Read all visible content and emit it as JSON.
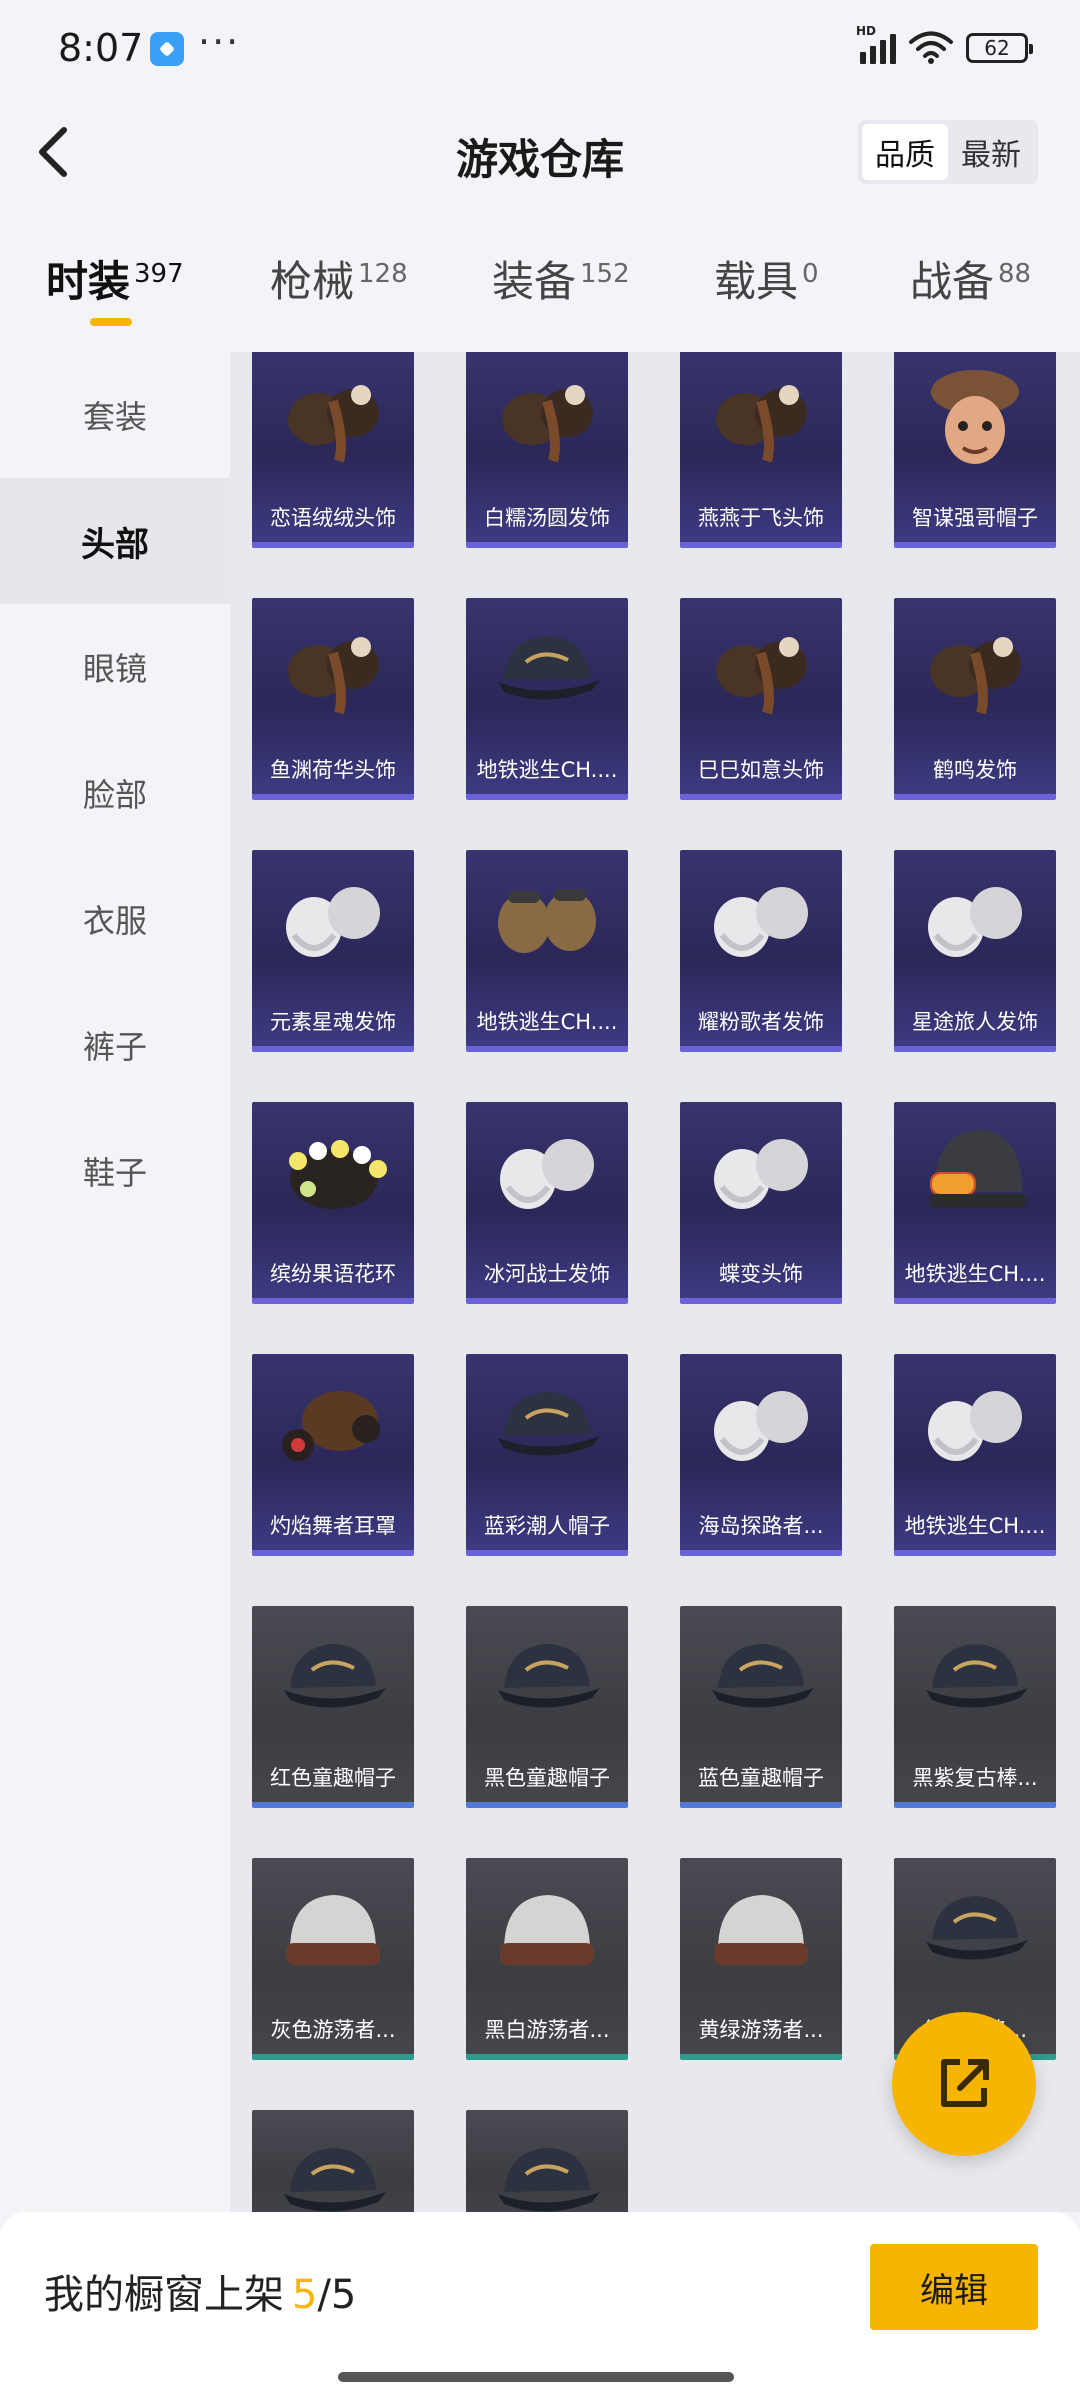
{
  "status_bar": {
    "time": "8:07",
    "more": "···",
    "network": "HD",
    "battery": "62"
  },
  "header": {
    "title": "游戏仓库",
    "sort_options": [
      {
        "label": "品质",
        "active": true
      },
      {
        "label": "最新",
        "active": false
      }
    ]
  },
  "category_tabs": [
    {
      "label": "时装",
      "count": "397",
      "active": true
    },
    {
      "label": "枪械",
      "count": "128",
      "active": false
    },
    {
      "label": "装备",
      "count": "152",
      "active": false
    },
    {
      "label": "载具",
      "count": "0",
      "active": false
    },
    {
      "label": "战备",
      "count": "88",
      "active": false
    }
  ],
  "sidebar": {
    "items": [
      {
        "label": "套装",
        "active": false
      },
      {
        "label": "头部",
        "active": true
      },
      {
        "label": "眼镜",
        "active": false
      },
      {
        "label": "脸部",
        "active": false
      },
      {
        "label": "衣服",
        "active": false
      },
      {
        "label": "裤子",
        "active": false
      },
      {
        "label": "鞋子",
        "active": false
      }
    ]
  },
  "items": [
    {
      "name": "恋语绒绒头饰",
      "rarity": "purple",
      "icon": "hair-accessory-icon"
    },
    {
      "name": "白糯汤圆发饰",
      "rarity": "purple",
      "icon": "hair-accessory-icon"
    },
    {
      "name": "燕燕于飞头饰",
      "rarity": "purple",
      "icon": "hair-accessory-icon"
    },
    {
      "name": "智谋强哥帽子",
      "rarity": "purple",
      "icon": "character-hat-icon"
    },
    {
      "name": "鱼渊荷华头饰",
      "rarity": "purple",
      "icon": "hair-accessory-icon"
    },
    {
      "name": "地铁逃生CH....",
      "rarity": "purple",
      "icon": "cap-icon"
    },
    {
      "name": "巳巳如意头饰",
      "rarity": "purple",
      "icon": "hair-accessory-icon"
    },
    {
      "name": "鹤鸣发饰",
      "rarity": "purple",
      "icon": "hair-accessory-icon"
    },
    {
      "name": "元素星魂发饰",
      "rarity": "purple",
      "icon": "wig-icon"
    },
    {
      "name": "地铁逃生CH....",
      "rarity": "purple",
      "icon": "aviator-hat-icon"
    },
    {
      "name": "耀粉歌者发饰",
      "rarity": "purple",
      "icon": "wig-icon"
    },
    {
      "name": "星途旅人发饰",
      "rarity": "purple",
      "icon": "wig-icon"
    },
    {
      "name": "缤纷果语花环",
      "rarity": "purple",
      "icon": "flower-crown-icon"
    },
    {
      "name": "冰河战士发饰",
      "rarity": "purple",
      "icon": "wig-icon"
    },
    {
      "name": "蝶变头饰",
      "rarity": "purple",
      "icon": "wig-icon"
    },
    {
      "name": "地铁逃生CH....",
      "rarity": "purple",
      "icon": "beanie-goggles-icon"
    },
    {
      "name": "灼焰舞者耳罩",
      "rarity": "purple",
      "icon": "earmuffs-icon"
    },
    {
      "name": "蓝彩潮人帽子",
      "rarity": "purple",
      "icon": "cap-icon"
    },
    {
      "name": "海岛探路者...",
      "rarity": "purple",
      "icon": "wig-icon"
    },
    {
      "name": "地铁逃生CH....",
      "rarity": "purple",
      "icon": "wig-icon"
    },
    {
      "name": "红色童趣帽子",
      "rarity": "gray-blue",
      "icon": "cap-icon"
    },
    {
      "name": "黑色童趣帽子",
      "rarity": "gray-blue",
      "icon": "cap-icon"
    },
    {
      "name": "蓝色童趣帽子",
      "rarity": "gray-blue",
      "icon": "cap-icon"
    },
    {
      "name": "黑紫复古棒...",
      "rarity": "gray-blue",
      "icon": "cap-icon"
    },
    {
      "name": "灰色游荡者...",
      "rarity": "gray-teal",
      "icon": "beanie-icon"
    },
    {
      "name": "黑白游荡者...",
      "rarity": "gray-teal",
      "icon": "beanie-icon"
    },
    {
      "name": "黄绿游荡者...",
      "rarity": "gray-teal",
      "icon": "beanie-icon"
    },
    {
      "name": "红白先锋...",
      "rarity": "gray-teal",
      "icon": "cap-icon"
    },
    {
      "name": "",
      "rarity": "gray-partial",
      "icon": "cap-icon"
    },
    {
      "name": "",
      "rarity": "gray-partial",
      "icon": "cap-icon"
    }
  ],
  "fab": {
    "icon": "share-external-icon"
  },
  "bottom_bar": {
    "label": "我的橱窗上架",
    "current": "5",
    "total": "/5",
    "edit_label": "编辑"
  },
  "colors": {
    "accent": "#f7b500",
    "purple_card": "#2b2858",
    "gray_card": "#3c3d43"
  }
}
